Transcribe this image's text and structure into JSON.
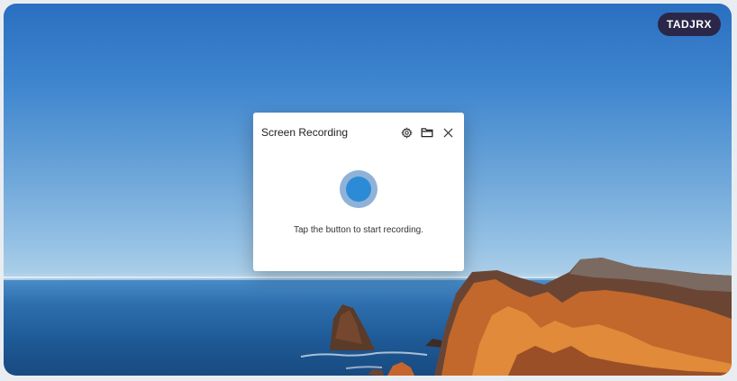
{
  "badge": {
    "label": "TADJRX"
  },
  "dialog": {
    "title": "Screen Recording",
    "hint": "Tap the button to start recording.",
    "icons": [
      "gear-icon",
      "folder-icon",
      "close-icon"
    ]
  },
  "colors": {
    "badge_bg": "#2b2748",
    "record_outer": "#8fb2d8",
    "record_inner": "#2b8bd6"
  }
}
